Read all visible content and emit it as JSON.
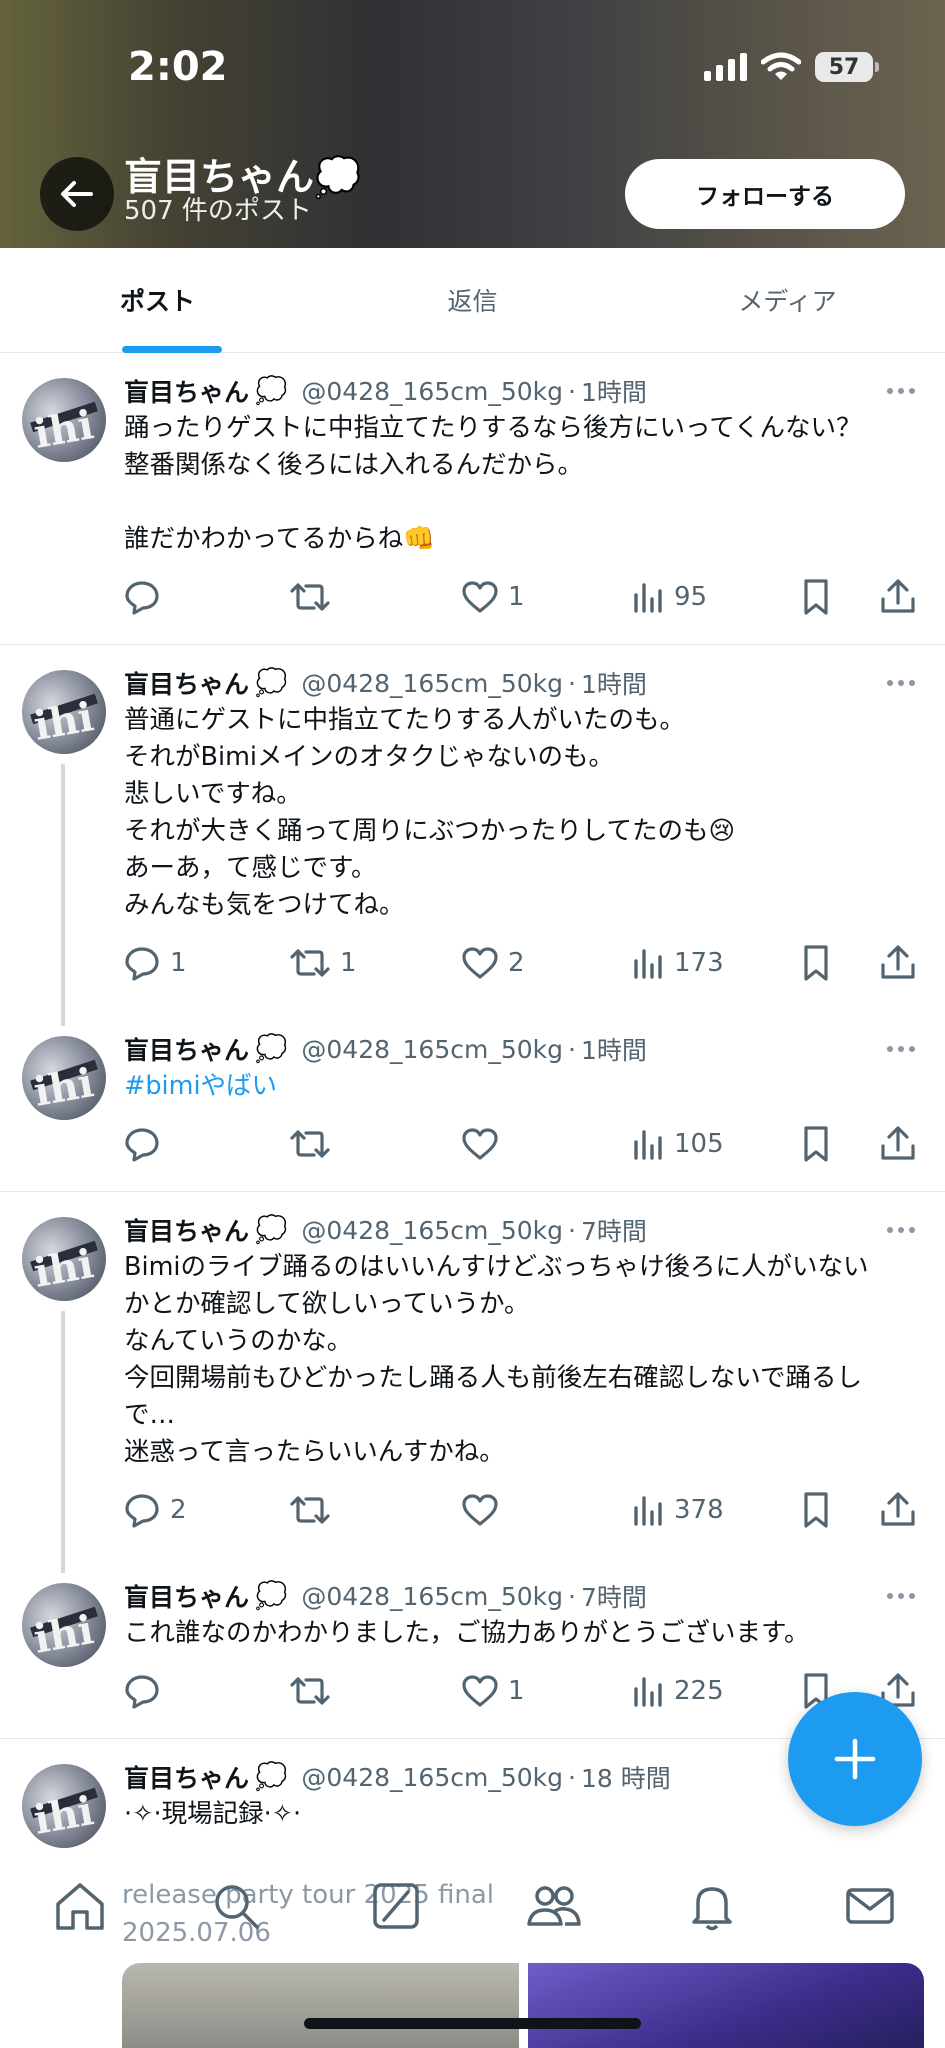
{
  "status": {
    "time": "2:02",
    "battery": "57"
  },
  "header": {
    "name": "盲目ちゃん💭",
    "post_count": "507 件のポスト",
    "follow_label": "フォローする"
  },
  "tabs": [
    {
      "label": "ポスト"
    },
    {
      "label": "返信"
    },
    {
      "label": "メディア"
    }
  ],
  "posts": [
    {
      "name": "盲目ちゃん",
      "handle": "@0428_165cm_50kg",
      "time": "1時間",
      "text": "踊ったりゲストに中指立てたりするなら後方にいってくんない？\n整番関係なく後ろには入れるんだから。\n\n誰だかわかってるからね👊",
      "replies": "",
      "reposts": "",
      "likes": "1",
      "views": "95"
    },
    {
      "name": "盲目ちゃん",
      "handle": "@0428_165cm_50kg",
      "time": "1時間",
      "text": "普通にゲストに中指立てたりする人がいたのも。\nそれがBimiメインのオタクじゃないのも。\n悲しいですね。\nそれが大きく踊って周りにぶつかったりしてたのも😢\nあーあ，て感じです。\nみんなも気をつけてね。",
      "replies": "1",
      "reposts": "1",
      "likes": "2",
      "views": "173"
    },
    {
      "name": "盲目ちゃん",
      "handle": "@0428_165cm_50kg",
      "time": "1時間",
      "text": "#bimiやばい",
      "replies": "",
      "reposts": "",
      "likes": "",
      "views": "105"
    },
    {
      "name": "盲目ちゃん",
      "handle": "@0428_165cm_50kg",
      "time": "7時間",
      "text": "Bimiのライブ踊るのはいいんすけどぶっちゃけ後ろに人がいない\nかとか確認して欲しいっていうか。\nなんていうのかな。\n今回開場前もひどかったし踊る人も前後左右確認しないで踊るし\nで…\n迷惑って言ったらいいんすかね。",
      "replies": "2",
      "reposts": "",
      "likes": "",
      "views": "378"
    },
    {
      "name": "盲目ちゃん",
      "handle": "@0428_165cm_50kg",
      "time": "7時間",
      "text": "これ誰なのかわかりました，ご協力ありがとうございます。",
      "replies": "",
      "reposts": "",
      "likes": "1",
      "views": "225"
    },
    {
      "name": "盲目ちゃん",
      "handle": "@0428_165cm_50kg",
      "time": "18 時間",
      "text": "·✧·現場記録·✧·",
      "replies": "",
      "reposts": "",
      "likes": "",
      "views": ""
    }
  ],
  "post_bubble": "💭",
  "time_sep": "·",
  "bottom_caption": "release party tour 2025 final\n2025.07.06",
  "colors": {
    "accent": "#1d9bf0",
    "text": "#0f1419",
    "muted": "#536471"
  },
  "icons": [
    "back-arrow-icon",
    "reply-icon",
    "repost-icon",
    "like-icon",
    "views-icon",
    "bookmark-icon",
    "share-icon",
    "more-icon",
    "compose-plus-icon",
    "home-icon",
    "search-icon",
    "grok-icon",
    "communities-icon",
    "notifications-icon",
    "messages-icon"
  ]
}
